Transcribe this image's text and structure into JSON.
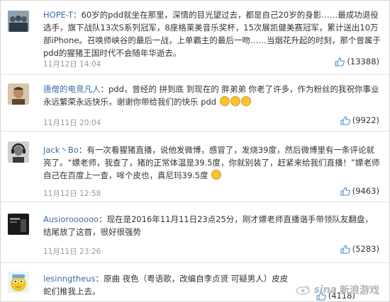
{
  "comments": [
    {
      "username": "HOPE-T",
      "text": "60岁的pdd就坐在那里，深情的目光望过去，都是自己20岁的身影……最成功退役选手，旗下战队13次S系列冠军，8座格莱美音乐奖杯，15次展凯健美赛冠军，累计送出10万部iPhone。召唤师峡谷的最后一战，上单霸主的最后一吻……当烟花升起的时刻，那个曾属于pdd的猩猪王国时代不会随年华逝去。",
      "time": "11月12日 14:04",
      "likes": "(13388)",
      "avatar_colors": [
        "#5d6d7a",
        "#a9b6bd"
      ]
    },
    {
      "username": "唐僧的电竞凡人",
      "text": "pdd，曾经的 拼到底 到现在的 胖弟弟 你老了许多，作为粉丝的我祝你事业永远繁荣永远快乐，谢谢你带给我们的快乐 pdd",
      "time": "11月11日 20:04",
      "likes": "(9922)",
      "avatar_colors": [
        "#c8a27a",
        "#6b4a32"
      ]
    },
    {
      "username": "Jack丶Bo",
      "text": "有一次看猩猪直播，说他发微博，感冒了，发烧39度，然后微博里有一条评论就亮了。“嫖老师，我查了，猪的正常体温是39.5度，你就别装了，赶紧来给我们直播！”嫖老师自己在百度上一查，哞个皮也，真尼玛39.5度",
      "time": "11月12日 12:58",
      "likes": "(9463)",
      "avatar_colors": [
        "#3d3d3d",
        "#bdbdbd"
      ]
    },
    {
      "username": "Ausioroooooo",
      "text": "现在是2016年11月11日23点25分，刚才嫖老师直播谐手带领队友翻盘，结尾放了这首，很好很强势",
      "time": "11月11日 23:26",
      "likes": "(5283)",
      "avatar_colors": [
        "#1e1e1e",
        "#777777"
      ]
    },
    {
      "username": "lesinngtheus",
      "text": "原曲 夜色（粤语歌，改编自李贞贤 可疑男人）皮皮蛇们推我上去。",
      "time": "",
      "likes": "(4118)",
      "avatar_colors": [
        "#f2c531",
        "#e08a1e"
      ]
    }
  ],
  "watermark": {
    "logo_text": "sina",
    "label": "新浪游戏"
  },
  "colors": {
    "username": "#3a6ea5",
    "meta": "#999999",
    "divider": "#e4e4e4"
  }
}
